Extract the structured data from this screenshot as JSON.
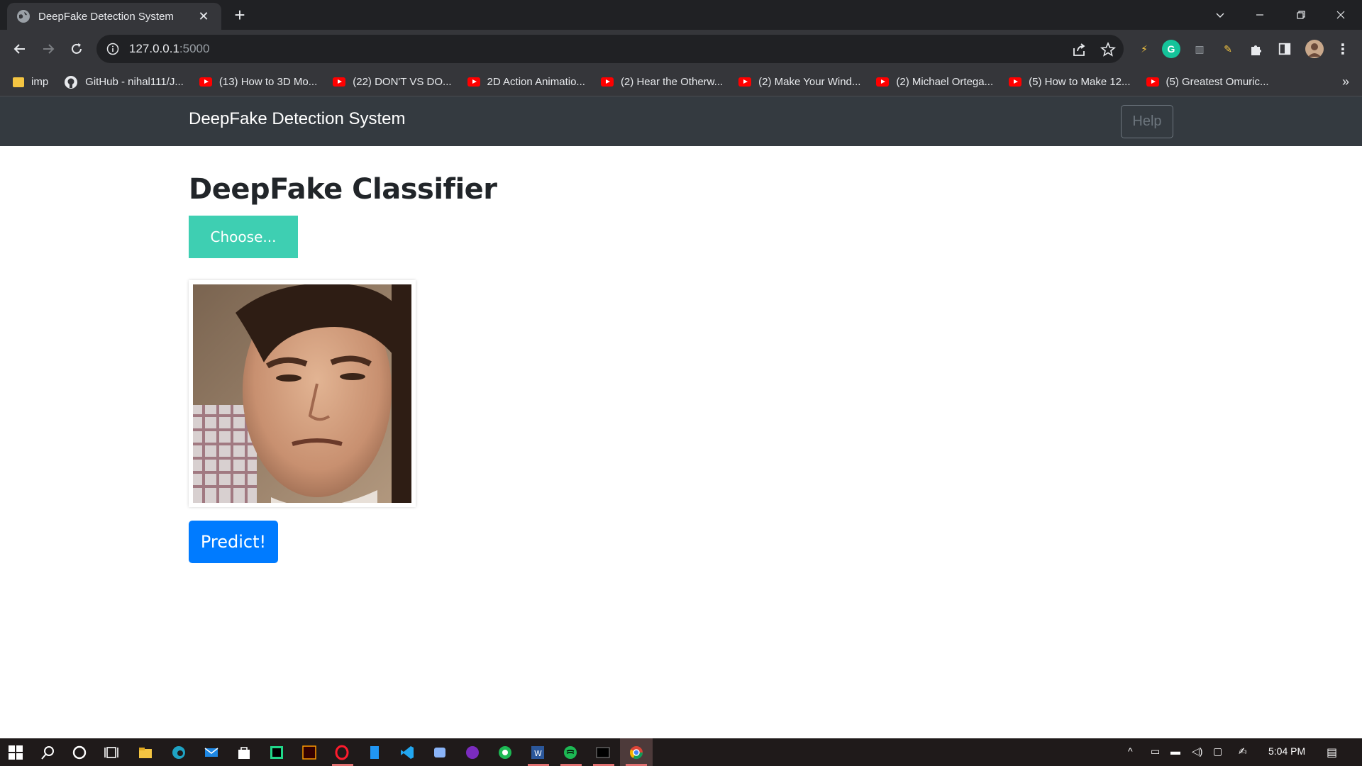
{
  "browser": {
    "tab_title": "DeepFake Detection System",
    "url_host": "127.0.0.1",
    "url_port": ":5000",
    "bookmarks_more": "»",
    "bookmarks": [
      {
        "icon": "folder-icon",
        "label": "imp"
      },
      {
        "icon": "github-icon",
        "label": "GitHub - nihal111/J..."
      },
      {
        "icon": "youtube-icon",
        "label": "(13) How to 3D Mo..."
      },
      {
        "icon": "youtube-icon",
        "label": "(22) DON'T VS DO..."
      },
      {
        "icon": "youtube-icon",
        "label": "2D Action Animatio..."
      },
      {
        "icon": "youtube-icon",
        "label": "(2) Hear the Otherw..."
      },
      {
        "icon": "youtube-icon",
        "label": "(2) Make Your Wind..."
      },
      {
        "icon": "youtube-icon",
        "label": "(2) Michael Ortega..."
      },
      {
        "icon": "youtube-icon",
        "label": "(5) How to Make 12..."
      },
      {
        "icon": "youtube-icon",
        "label": "(5) Greatest Omuric..."
      }
    ]
  },
  "navbar": {
    "brand": "DeepFake Detection System",
    "help_label": "Help"
  },
  "main": {
    "heading": "DeepFake Classifier",
    "choose_label": "Choose...",
    "predict_label": "Predict!"
  },
  "taskbar": {
    "time": "5:04 PM"
  },
  "colors": {
    "navbar_bg": "#343a40",
    "choose_bg": "#3ecfb2",
    "predict_bg": "#007bff",
    "chrome_dark": "#202124",
    "chrome_toolbar": "#35363a"
  }
}
